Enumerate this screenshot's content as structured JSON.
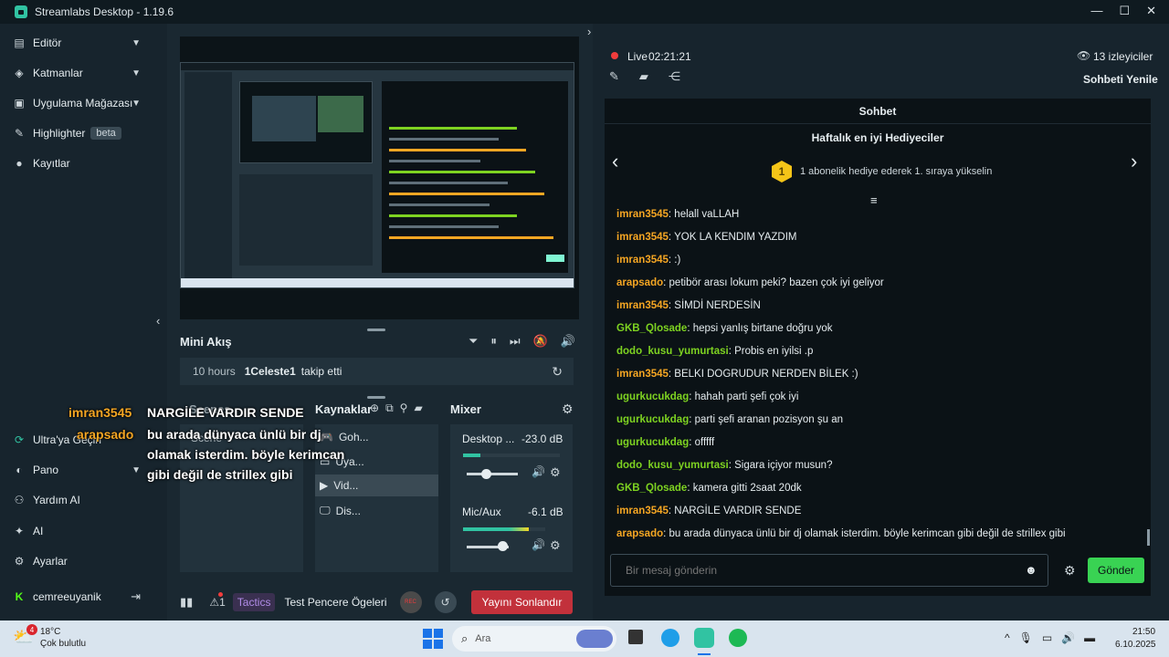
{
  "window": {
    "title": "Streamlabs Desktop - 1.19.6",
    "minimize": "—",
    "maximize": "☐",
    "close": "✕"
  },
  "sidebar": {
    "top_items": [
      {
        "label": "Editör",
        "icon": "editor-icon"
      },
      {
        "label": "Katmanlar",
        "icon": "layers-icon"
      },
      {
        "label": "Uygulama Mağazası",
        "icon": "store-icon"
      },
      {
        "label": "Highlighter",
        "icon": "highlighter-icon",
        "badge": "beta"
      },
      {
        "label": "Kayıtlar",
        "icon": "recordings-icon"
      }
    ],
    "bottom_items": [
      {
        "label": "Ultra'ya Geçin",
        "icon": "ultra-icon"
      },
      {
        "label": "Pano",
        "icon": "dashboard-icon"
      },
      {
        "label": "Yardım AI",
        "icon": "help-ai-icon"
      },
      {
        "label": "AI",
        "icon": "ai-icon"
      },
      {
        "label": "Ayarlar",
        "icon": "settings-icon"
      }
    ],
    "user": {
      "name": "cemreeuyanik",
      "logout": "⇥"
    }
  },
  "mini_feed": {
    "title": "Mini Akış",
    "row": {
      "time": "10 hours",
      "user": "1Celeste1",
      "action": "takip etti"
    }
  },
  "docks": {
    "scenes_title": "Scenes",
    "scene_item": "Scene",
    "sources_title": "Kaynaklar",
    "sources": [
      {
        "label": "Goh...",
        "icon": "gamepad-icon"
      },
      {
        "label": "Uya...",
        "icon": "window-icon"
      },
      {
        "label": "Vid...",
        "icon": "video-icon"
      },
      {
        "label": "Dis...",
        "icon": "monitor-icon"
      }
    ],
    "mixer_title": "Mixer",
    "mixer": [
      {
        "name": "Desktop ...",
        "db": "-23.0 dB",
        "level": 0.18
      },
      {
        "name": "Mic/Aux",
        "db": "-6.1 dB",
        "level": 0.45
      }
    ]
  },
  "footer": {
    "stats_icon": "stats-icon",
    "alert_count": "1",
    "tactics_label": "Tactics",
    "test_widgets_label": "Test Pencere Ögeleri",
    "rec_label": "REC",
    "end_stream_label": "Yayını Sonlandır"
  },
  "stream": {
    "live_label": "Live",
    "live_time": "02:21:21",
    "viewers": "13 izleyiciler",
    "refresh_chat": "Sohbeti Yenile"
  },
  "chat": {
    "header": "Sohbet",
    "top_gifters_title": "Haftalık en iyi Hediyeciler",
    "rank": "1",
    "rank_text": "1 abonelik hediye ederek 1. sıraya yükselin",
    "messages": [
      {
        "user": "imran3545",
        "text": ": helall vaLLAH",
        "color": "orange"
      },
      {
        "user": "imran3545",
        "text": ": YOK LA KENDIM YAZDIM",
        "color": "orange"
      },
      {
        "user": "imran3545",
        "text": ": :)",
        "color": "orange"
      },
      {
        "user": "arapsado",
        "text": ": petibör arası lokum peki? bazen çok iyi geliyor",
        "color": "orange"
      },
      {
        "user": "imran3545",
        "text": ": SİMDİ NERDESİN",
        "color": "orange"
      },
      {
        "user": "GKB_Qlosade",
        "text": ": hepsi yanlış birtane doğru yok",
        "color": "green"
      },
      {
        "user": "dodo_kusu_yumurtasi",
        "text": ": Probis en iyilsi .p",
        "color": "green"
      },
      {
        "user": "imran3545",
        "text": ": BELKI DOGRUDUR NERDEN BİLEK :)",
        "color": "orange"
      },
      {
        "user": "ugurkucukdag",
        "text": ": hahah parti şefi çok iyi",
        "color": "green"
      },
      {
        "user": "ugurkucukdag",
        "text": ": parti şefi aranan pozisyon şu an",
        "color": "green"
      },
      {
        "user": "ugurkucukdag",
        "text": ": offfff",
        "color": "green"
      },
      {
        "user": "dodo_kusu_yumurtasi",
        "text": ": Sigara içiyor musun?",
        "color": "green"
      },
      {
        "user": "GKB_Qlosade",
        "text": ": kamera gitti 2saat 20dk",
        "color": "green"
      },
      {
        "user": "imran3545",
        "text": ": NARGİLE VARDIR SENDE",
        "color": "orange"
      },
      {
        "user": "arapsado",
        "text": ": bu arada dünyaca ünlü bir dj olamak isterdim. böyle kerimcan gibi değil de strillex gibi",
        "color": "orange"
      }
    ],
    "input_placeholder": "Bir mesaj gönderin",
    "send_label": "Gönder"
  },
  "overlay": {
    "line1_user": "imran3545",
    "line1_text": "NARGİLE VARDIR SENDE",
    "line2_user": "arapsado",
    "line2_text": "bu arada dünyaca ünlü bir dj olamak isterdim. böyle kerimcan gibi değil de strillex gibi"
  },
  "taskbar": {
    "weather_temp": "18°C",
    "weather_desc": "Çok bulutlu",
    "weather_badge": "4",
    "search_placeholder": "Ara",
    "time": "21:50",
    "date": "6.10.2025"
  },
  "colors": {
    "accent": "#31c3a2",
    "send": "#80f5d2",
    "live": "#f03c3c",
    "end_stream": "#c2313b",
    "tactics": "#b18ce8"
  }
}
